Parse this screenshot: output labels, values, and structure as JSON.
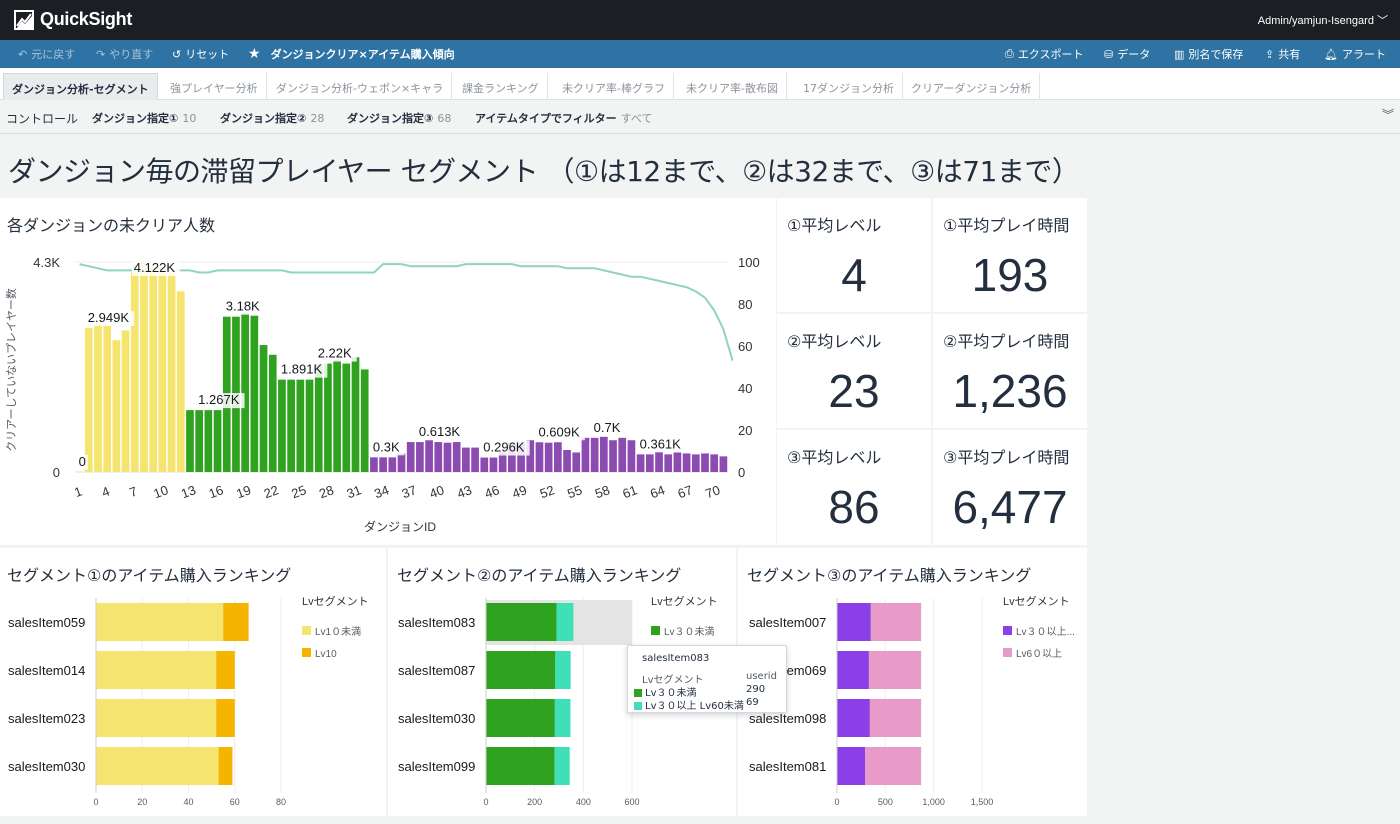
{
  "app": {
    "name": "QuickSight",
    "user": "Admin/yamjun-Isengard"
  },
  "toolbar": {
    "undo": "元に戻す",
    "redo": "やり直す",
    "reset": "リセット",
    "analysis_title": "ダンジョンクリア×アイテム購入傾向",
    "export": "エクスポート",
    "data": "データ",
    "save_as": "別名で保存",
    "share": "共有",
    "alert": "アラート"
  },
  "tabs": [
    "ダンジョン分析-セグメント",
    "強プレイヤー分析",
    "ダンジョン分析-ウェポン×キャラ",
    "課金ランキング",
    "未クリア率-棒グラフ",
    "未クリア率-散布図",
    "17ダンジョン分析",
    "クリアーダンジョン分析"
  ],
  "controls": {
    "label": "コントロール",
    "items": [
      {
        "name": "ダンジョン指定①",
        "value": "10"
      },
      {
        "name": "ダンジョン指定②",
        "value": "28"
      },
      {
        "name": "ダンジョン指定③",
        "value": "68"
      },
      {
        "name": "アイテムタイプでフィルター",
        "value": "すべて"
      }
    ]
  },
  "page_title": "ダンジョン毎の滞留プレイヤー セグメント （①は12まで、②は32まで、③は71まで）",
  "kpis": [
    {
      "title": "①平均レベル",
      "value": "4"
    },
    {
      "title": "①平均プレイ時間",
      "value": "193"
    },
    {
      "title": "②平均レベル",
      "value": "23"
    },
    {
      "title": "②平均プレイ時間",
      "value": "1,236"
    },
    {
      "title": "③平均レベル",
      "value": "86"
    },
    {
      "title": "③平均プレイ時間",
      "value": "6,477"
    }
  ],
  "colors": {
    "yellow": "#f5e46e",
    "green": "#2fa31f",
    "purple": "#8c4bb0",
    "line": "#8fd3c4",
    "orange": "#f5b400",
    "teal": "#3fe0b8",
    "violet": "#8b3fe6",
    "pink": "#e89ac8"
  },
  "chart_data": [
    {
      "type": "bar",
      "title": "各ダンジョンの未クリア人数",
      "xlabel": "ダンジョンID",
      "ylabel": "クリアーしていないプレイヤー数",
      "y_left_ticks": [
        "4.3K",
        "0"
      ],
      "y_right_ticks": [
        "100",
        "80",
        "60",
        "40",
        "20",
        "0"
      ],
      "x_ticks": [
        "1",
        "4",
        "7",
        "10",
        "13",
        "16",
        "19",
        "22",
        "25",
        "28",
        "31",
        "34",
        "37",
        "40",
        "43",
        "46",
        "49",
        "52",
        "55",
        "58",
        "61",
        "64",
        "67",
        "70"
      ],
      "ylim": [
        0,
        4300
      ],
      "y2lim": [
        0,
        100
      ],
      "x": [
        1,
        2,
        3,
        4,
        5,
        6,
        7,
        8,
        9,
        10,
        11,
        12,
        13,
        14,
        15,
        16,
        17,
        18,
        19,
        20,
        21,
        22,
        23,
        24,
        25,
        26,
        27,
        28,
        29,
        30,
        31,
        32,
        33,
        34,
        35,
        36,
        37,
        38,
        39,
        40,
        41,
        42,
        43,
        44,
        45,
        46,
        47,
        48,
        49,
        50,
        51,
        52,
        53,
        54,
        55,
        56,
        57,
        58,
        59,
        60,
        61,
        62,
        63,
        64,
        65,
        66,
        67,
        68,
        69,
        70,
        71
      ],
      "series": [
        {
          "segment": "①",
          "x_range": [
            1,
            12
          ],
          "values": [
            0,
            2949,
            3050,
            3000,
            2700,
            2900,
            4122,
            4300,
            4250,
            4200,
            4100,
            3700
          ]
        },
        {
          "segment": "②",
          "x_range": [
            13,
            32
          ],
          "values": [
            1267,
            1267,
            1267,
            1267,
            3180,
            3180,
            3250,
            3200,
            2600,
            2400,
            1891,
            1891,
            1891,
            1891,
            2220,
            2220,
            2300,
            2220,
            2350,
            2100
          ]
        },
        {
          "segment": "③",
          "x_range": [
            33,
            71
          ],
          "values": [
            300,
            300,
            300,
            380,
            613,
            613,
            650,
            613,
            600,
            613,
            500,
            500,
            296,
            296,
            400,
            609,
            609,
            650,
            609,
            600,
            609,
            450,
            400,
            700,
            700,
            720,
            650,
            700,
            650,
            361,
            361,
            420,
            361,
            400,
            380,
            361,
            380,
            361,
            320
          ]
        },
        {
          "name": "line",
          "axis": "right",
          "values": [
            99,
            98,
            97,
            96,
            96,
            96,
            96,
            96,
            97,
            97,
            96,
            96,
            96,
            95,
            95,
            96,
            96,
            96,
            96,
            96,
            96,
            96,
            96,
            95,
            95,
            95,
            95,
            95,
            95,
            95,
            95,
            95,
            95,
            99,
            99,
            99,
            98,
            98,
            98,
            98,
            98,
            98,
            99,
            99,
            99,
            99,
            99,
            99,
            98,
            98,
            98,
            98,
            98,
            97,
            97,
            97,
            97,
            96,
            95,
            94,
            93,
            93,
            92,
            91,
            90,
            89,
            88,
            86,
            83,
            77,
            68,
            53
          ]
        }
      ],
      "data_labels": [
        {
          "x": 1,
          "label": "0"
        },
        {
          "x": 2,
          "label": "2.949K"
        },
        {
          "x": 7,
          "label": "4.122K"
        },
        {
          "x": 14,
          "label": "1.267K"
        },
        {
          "x": 17,
          "label": "3.18K"
        },
        {
          "x": 23,
          "label": "1.891K"
        },
        {
          "x": 27,
          "label": "2.22K"
        },
        {
          "x": 33,
          "label": "0.3K"
        },
        {
          "x": 38,
          "label": "0.613K"
        },
        {
          "x": 45,
          "label": "0.296K"
        },
        {
          "x": 51,
          "label": "0.609K"
        },
        {
          "x": 57,
          "label": "0.7K"
        },
        {
          "x": 62,
          "label": "0.361K"
        }
      ]
    },
    {
      "type": "bar",
      "orientation": "horizontal-stacked",
      "title": "セグメント①のアイテム購入ランキング",
      "legend_title": "Lvセグメント",
      "categories": [
        "salesItem059",
        "salesItem014",
        "salesItem023",
        "salesItem030"
      ],
      "series": [
        {
          "name": "Lv1０未満",
          "values": [
            55,
            52,
            52,
            53
          ]
        },
        {
          "name": "Lv10",
          "values": [
            11,
            8,
            8,
            6
          ]
        }
      ],
      "x_ticks": [
        "0",
        "20",
        "40",
        "60",
        "80"
      ],
      "xlim": [
        0,
        80
      ]
    },
    {
      "type": "bar",
      "orientation": "horizontal-stacked",
      "title": "セグメント②のアイテム購入ランキング",
      "legend_title": "Lvセグメント",
      "categories": [
        "salesItem083",
        "salesItem087",
        "salesItem030",
        "salesItem099"
      ],
      "series": [
        {
          "name": "Lv３０未満",
          "values": [
            290,
            285,
            283,
            282
          ]
        },
        {
          "name": "Lv３０以上 Lv60未満",
          "values": [
            69,
            63,
            64,
            62
          ]
        }
      ],
      "x_ticks": [
        "0",
        "200",
        "400",
        "600"
      ],
      "xlim": [
        0,
        600
      ]
    },
    {
      "type": "bar",
      "orientation": "horizontal-stacked",
      "title": "セグメント③のアイテム購入ランキング",
      "legend_title": "Lvセグメント",
      "categories": [
        "salesItem007",
        "salesItem069",
        "salesItem098",
        "salesItem081"
      ],
      "series": [
        {
          "name": "Lv３０以上...",
          "values": [
            350,
            330,
            340,
            290
          ]
        },
        {
          "name": "Lv6０以上",
          "values": [
            520,
            540,
            530,
            580
          ]
        }
      ],
      "x_ticks": [
        "0",
        "500",
        "1,000",
        "1,500"
      ],
      "xlim": [
        0,
        1500
      ]
    }
  ],
  "tooltip": {
    "title": "salesItem083",
    "header_left": "Lvセグメント",
    "header_right": "userid",
    "rows": [
      {
        "label": "Lv３０未満",
        "value": "290"
      },
      {
        "label": "Lv３０以上 Lv60未満",
        "value": "69"
      }
    ]
  }
}
